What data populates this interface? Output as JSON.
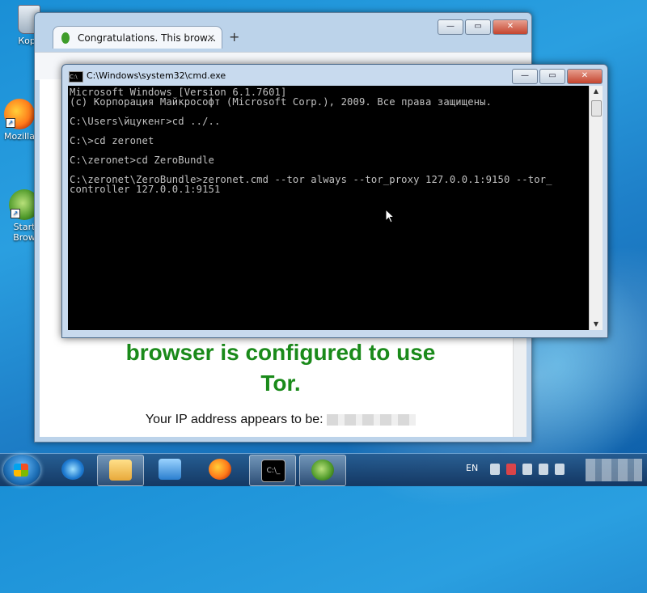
{
  "desktop": {
    "icons": [
      {
        "label": "Корз"
      },
      {
        "label": "Mozilla"
      },
      {
        "label": "Start\nBrow"
      }
    ]
  },
  "browser": {
    "tab_title": "Congratulations. This brow...",
    "tab_close": "✕",
    "new_tab": "+",
    "content": {
      "line1": "browser is configured to use",
      "line2": "Tor.",
      "ip_prefix": "Your IP address appears to be:"
    }
  },
  "cmd": {
    "title": "C:\\Windows\\system32\\cmd.exe",
    "lines": [
      "Microsoft Windows [Version 6.1.7601]",
      "(c) Корпорация Майкрософт (Microsoft Corp.), 2009. Все права защищены.",
      "",
      "C:\\Users\\йцукенг>cd ../..",
      "",
      "C:\\>cd zeronet",
      "",
      "C:\\zeronet>cd ZeroBundle",
      "",
      "C:\\zeronet\\ZeroBundle>zeronet.cmd --tor always --tor_proxy 127.0.0.1:9150 --tor_",
      "controller 127.0.0.1:9151"
    ]
  },
  "window_controls": {
    "minimize": "—",
    "maximize": "▭",
    "close": "✕"
  },
  "taskbar": {
    "language": "EN",
    "items": [
      "ie-icon",
      "explorer-icon",
      "media-player-icon",
      "firefox-icon",
      "cmd-icon",
      "tor-browser-icon"
    ],
    "active_items": [
      "explorer-icon",
      "cmd-icon",
      "tor-browser-icon"
    ]
  }
}
